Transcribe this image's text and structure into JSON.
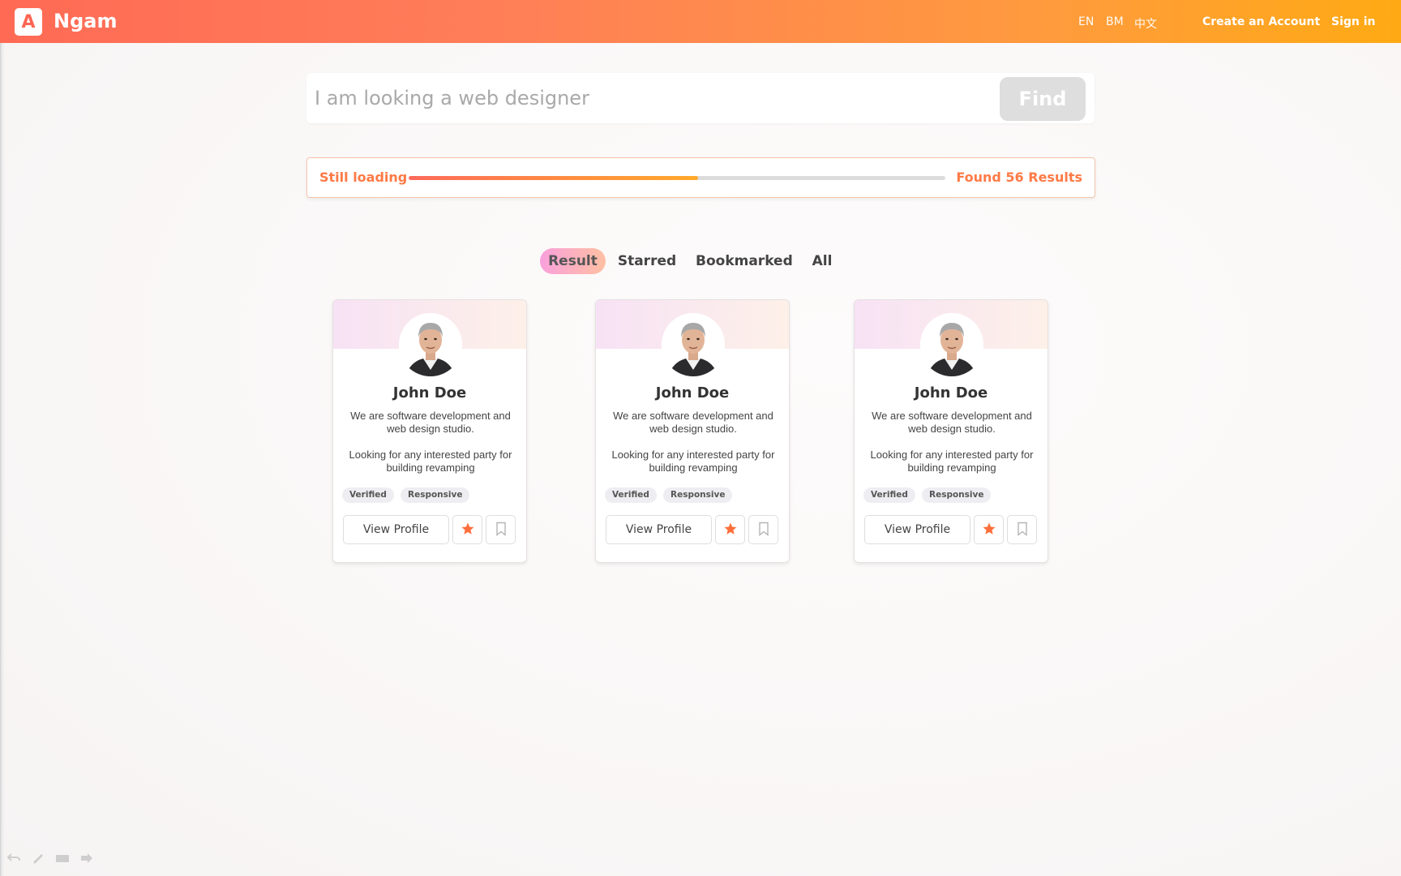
{
  "header": {
    "logo_letter": "A",
    "brand": "Ngam",
    "languages": [
      "EN",
      "BM",
      "中文"
    ],
    "create_account": "Create an Account",
    "sign_in": "Sign in"
  },
  "search": {
    "placeholder": "I am looking a web designer",
    "button": "Find"
  },
  "progress": {
    "status": "Still loading",
    "percent": 54,
    "found": "Found 56 Results"
  },
  "tabs": [
    {
      "label": "Result",
      "active": true
    },
    {
      "label": "Starred",
      "active": false
    },
    {
      "label": "Bookmarked",
      "active": false
    },
    {
      "label": "All",
      "active": false
    }
  ],
  "cards": [
    {
      "name": "John Doe",
      "desc1": "We are software development and web design studio.",
      "desc2": "Looking for any interested party for building revamping",
      "tags": [
        "Verified",
        "Responsive"
      ],
      "view_label": "View Profile",
      "starred": true,
      "bookmarked": false
    },
    {
      "name": "John Doe",
      "desc1": "We are software development and web design studio.",
      "desc2": "Looking for any interested party for building revamping",
      "tags": [
        "Verified",
        "Responsive"
      ],
      "view_label": "View Profile",
      "starred": true,
      "bookmarked": false
    },
    {
      "name": "John Doe",
      "desc1": "We are software development and web design studio.",
      "desc2": "Looking for any interested party for building revamping",
      "tags": [
        "Verified",
        "Responsive"
      ],
      "view_label": "View Profile",
      "starred": true,
      "bookmarked": false
    }
  ],
  "colors": {
    "accent": "#ff7a45",
    "header_start": "#ff6a55",
    "header_end": "#ffaa14",
    "star": "#ff6f3c"
  }
}
